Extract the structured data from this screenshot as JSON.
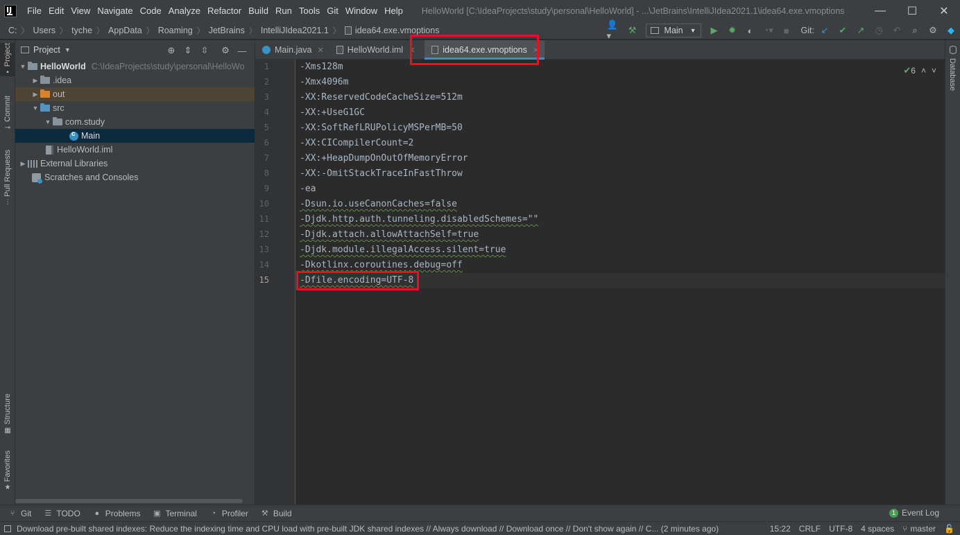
{
  "menubar": {
    "logo_text": "IJ",
    "items": [
      "File",
      "Edit",
      "View",
      "Navigate",
      "Code",
      "Analyze",
      "Refactor",
      "Build",
      "Run",
      "Tools",
      "Git",
      "Window",
      "Help"
    ],
    "window_title": "HelloWorld [C:\\IdeaProjects\\study\\personal\\HelloWorld] - ...\\JetBrains\\IntelliJIdea2021.1\\idea64.exe.vmoptions",
    "controls": [
      "—",
      "☐",
      "✕"
    ]
  },
  "navbar": {
    "breadcrumb": [
      "C:",
      "Users",
      "tyche",
      "AppData",
      "Roaming",
      "JetBrains",
      "IntelliJIdea2021.1",
      "idea64.exe.vmoptions"
    ],
    "run_config": "Main",
    "git_label": "Git:"
  },
  "left_strip": [
    "Project",
    "Commit",
    "Pull Requests",
    "Structure",
    "Favorites"
  ],
  "right_strip": [
    "Database"
  ],
  "project": {
    "title": "Project",
    "tree": [
      {
        "label": "HelloWorld",
        "hint": "C:\\IdeaProjects\\study\\personal\\HelloWo"
      },
      {
        "label": ".idea"
      },
      {
        "label": "out"
      },
      {
        "label": "src"
      },
      {
        "label": "com.study"
      },
      {
        "label": "Main"
      },
      {
        "label": "HelloWorld.iml"
      },
      {
        "label": "External Libraries"
      },
      {
        "label": "Scratches and Consoles"
      }
    ]
  },
  "editor": {
    "tabs": [
      "Main.java",
      "HelloWorld.iml",
      "idea64.exe.vmoptions"
    ],
    "active_tab": "idea64.exe.vmoptions",
    "inspection_count": "6",
    "line_numbers": [
      "1",
      "2",
      "3",
      "4",
      "5",
      "6",
      "7",
      "8",
      "9",
      "10",
      "11",
      "12",
      "13",
      "14",
      "15"
    ],
    "lines": [
      "-Xms128m",
      "-Xmx4096m",
      "-XX:ReservedCodeCacheSize=512m",
      "-XX:+UseG1GC",
      "-XX:SoftRefLRUPolicyMSPerMB=50",
      "-XX:CICompilerCount=2",
      "-XX:+HeapDumpOnOutOfMemoryError",
      "-XX:-OmitStackTraceInFastThrow",
      "-ea",
      "-Dsun.io.useCanonCaches=false",
      "-Djdk.http.auth.tunneling.disabledSchemes=\"\"",
      "-Djdk.attach.allowAttachSelf=true",
      "-Djdk.module.illegalAccess.silent=true",
      "-Dkotlinx.coroutines.debug=off",
      "-Dfile.encoding=UTF-8"
    ],
    "current_line": "15"
  },
  "bottom_tools": [
    "Git",
    "TODO",
    "Problems",
    "Terminal",
    "Profiler",
    "Build"
  ],
  "event_log": {
    "label": "Event Log",
    "count": "1"
  },
  "status": {
    "message": "Download pre-built shared indexes: Reduce the indexing time and CPU load with pre-built JDK shared indexes // Always download // Download once // Don't show again // C... (2 minutes ago)",
    "position": "15:22",
    "line_sep": "CRLF",
    "encoding": "UTF-8",
    "indent": "4 spaces",
    "branch": "master"
  },
  "colors": {
    "accent": "#4a88c7",
    "highlight_box": "#e81123",
    "selection": "#0d293e"
  }
}
